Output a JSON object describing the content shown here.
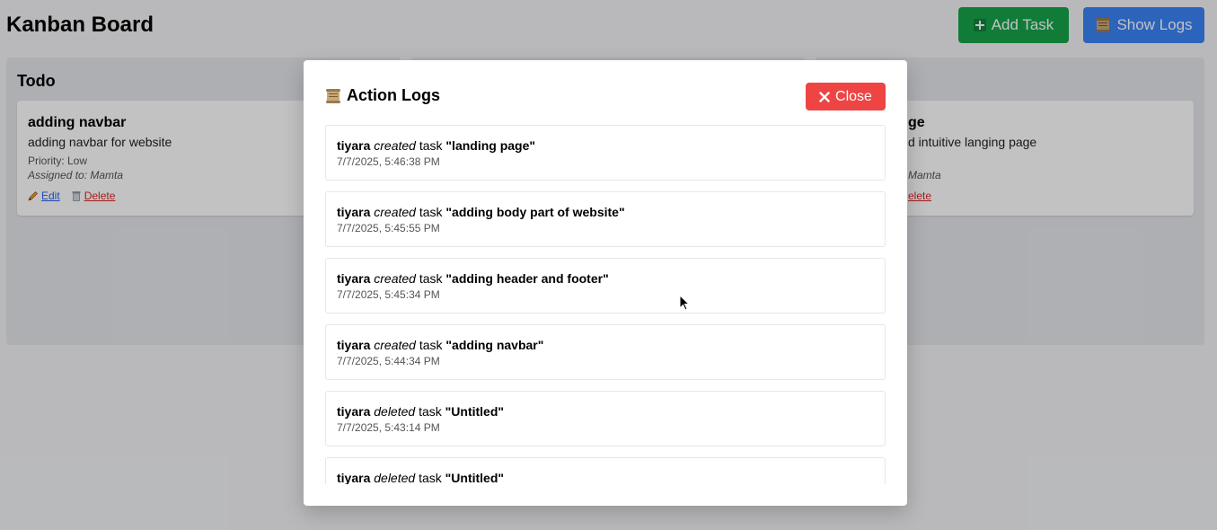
{
  "header": {
    "title": "Kanban Board",
    "add_task_label": "Add Task",
    "show_logs_label": "Show Logs"
  },
  "columns": [
    {
      "title": "Todo",
      "cards": [
        {
          "title": "adding navbar",
          "description": "adding navbar for website",
          "priority": "Priority: Low",
          "assigned": "Assigned to: Mamta",
          "edit_label": "Edit",
          "delete_label": "Delete"
        }
      ]
    },
    {
      "title": "",
      "cards": []
    },
    {
      "title": "",
      "cards": [
        {
          "title": "ge",
          "description": "d intuitive langing page",
          "priority": "",
          "assigned": "Mamta",
          "edit_label": "",
          "delete_label": "elete"
        }
      ]
    }
  ],
  "modal": {
    "title": "Action Logs",
    "close_label": "Close",
    "logs": [
      {
        "user": "tiyara",
        "action": "created",
        "word": "task",
        "target": "\"landing page\"",
        "time": "7/7/2025, 5:46:38 PM"
      },
      {
        "user": "tiyara",
        "action": "created",
        "word": "task",
        "target": "\"adding body part of website\"",
        "time": "7/7/2025, 5:45:55 PM"
      },
      {
        "user": "tiyara",
        "action": "created",
        "word": "task",
        "target": "\"adding header and footer\"",
        "time": "7/7/2025, 5:45:34 PM"
      },
      {
        "user": "tiyara",
        "action": "created",
        "word": "task",
        "target": "\"adding navbar\"",
        "time": "7/7/2025, 5:44:34 PM"
      },
      {
        "user": "tiyara",
        "action": "deleted",
        "word": "task",
        "target": "\"Untitled\"",
        "time": "7/7/2025, 5:43:14 PM"
      },
      {
        "user": "tiyara",
        "action": "deleted",
        "word": "task",
        "target": "\"Untitled\"",
        "time": ""
      }
    ]
  },
  "colors": {
    "add_button": "#16a34a",
    "logs_button": "#3b82f6",
    "close_button": "#ef4444",
    "edit_link": "#2563eb",
    "delete_link": "#dc2626"
  },
  "icons": {
    "add": "plus-icon",
    "logs": "scroll-icon",
    "close": "x-icon",
    "edit": "pencil-icon",
    "delete": "trash-icon"
  }
}
